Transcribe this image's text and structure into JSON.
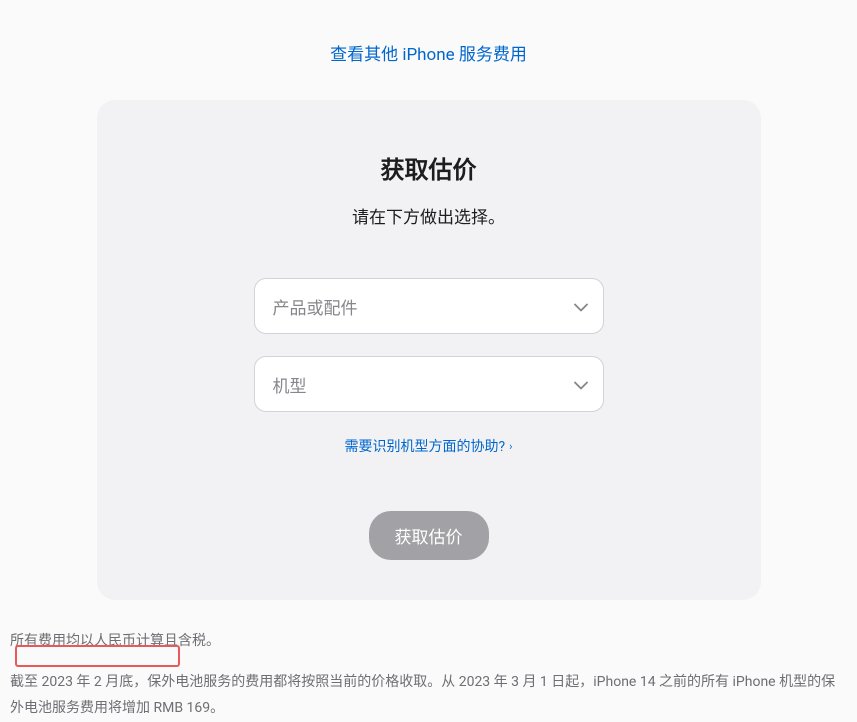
{
  "topLink": "查看其他 iPhone 服务费用",
  "card": {
    "title": "获取估价",
    "subtitle": "请在下方做出选择。",
    "select1": "产品或配件",
    "select2": "机型",
    "helpLink": "需要识别机型方面的协助?",
    "button": "获取估价"
  },
  "footer1": "所有费用均以人民币计算且含税。",
  "footer2": "截至 2023 年 2 月底，保外电池服务的费用都将按照当前的价格收取。从 2023 年 3 月 1 日起，iPhone 14 之前的所有 iPhone 机型的保外电池服务费用将增加 RMB 169。"
}
